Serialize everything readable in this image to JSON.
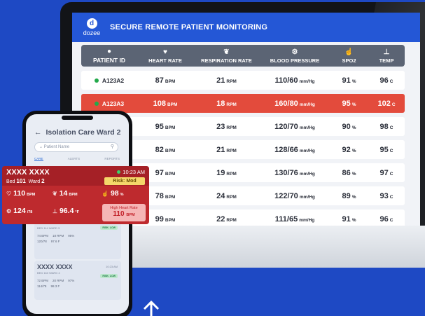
{
  "brand": {
    "logo_letter": "d",
    "logo_text": "dozee"
  },
  "app_title": "SECURE REMOTE PATIENT MONITORING",
  "columns": [
    {
      "label": "PATIENT ID",
      "icon": "person-icon"
    },
    {
      "label": "HEART RATE",
      "icon": "heart-icon"
    },
    {
      "label": "RESPIRATION RATE",
      "icon": "lungs-icon"
    },
    {
      "label": "BLOOD PRESSURE",
      "icon": "bp-icon"
    },
    {
      "label": "SPO2",
      "icon": "finger-icon"
    },
    {
      "label": "TEMP",
      "icon": "thermometer-icon"
    }
  ],
  "rows": [
    {
      "id": "A123A2",
      "hr": "87",
      "hr_unit": "BPM",
      "rr": "21",
      "rr_unit": "RPM",
      "bp": "110/60",
      "bp_unit": "mm/Hg",
      "spo2": "91",
      "spo2_unit": "%",
      "temp": "96",
      "temp_unit": "C",
      "alert": false
    },
    {
      "id": "A123A3",
      "hr": "108",
      "hr_unit": "BPM",
      "rr": "18",
      "rr_unit": "RPM",
      "bp": "160/80",
      "bp_unit": "mm/Hg",
      "spo2": "95",
      "spo2_unit": "%",
      "temp": "102",
      "temp_unit": "C",
      "alert": true
    },
    {
      "id": "",
      "hr": "95",
      "hr_unit": "BPM",
      "rr": "23",
      "rr_unit": "RPM",
      "bp": "120/70",
      "bp_unit": "mm/Hg",
      "spo2": "90",
      "spo2_unit": "%",
      "temp": "98",
      "temp_unit": "C",
      "alert": false
    },
    {
      "id": "",
      "hr": "82",
      "hr_unit": "BPM",
      "rr": "21",
      "rr_unit": "RPM",
      "bp": "128/66",
      "bp_unit": "mm/Hg",
      "spo2": "92",
      "spo2_unit": "%",
      "temp": "95",
      "temp_unit": "C",
      "alert": false
    },
    {
      "id": "",
      "hr": "97",
      "hr_unit": "BPM",
      "rr": "19",
      "rr_unit": "RPM",
      "bp": "130/76",
      "bp_unit": "mm/Hg",
      "spo2": "86",
      "spo2_unit": "%",
      "temp": "97",
      "temp_unit": "C",
      "alert": false
    },
    {
      "id": "",
      "hr": "78",
      "hr_unit": "BPM",
      "rr": "24",
      "rr_unit": "RPM",
      "bp": "122/70",
      "bp_unit": "mm/Hg",
      "spo2": "89",
      "spo2_unit": "%",
      "temp": "93",
      "temp_unit": "C",
      "alert": false
    },
    {
      "id": "",
      "hr": "99",
      "hr_unit": "BPM",
      "rr": "22",
      "rr_unit": "RPM",
      "bp": "111/65",
      "bp_unit": "mm/Hg",
      "spo2": "91",
      "spo2_unit": "%",
      "temp": "96",
      "temp_unit": "C",
      "alert": false
    }
  ],
  "phone": {
    "title": "Isolation Care Ward 2",
    "search_placeholder": "Patient Name",
    "tabs": [
      "CARE",
      "ALERTS",
      "REPORTS"
    ],
    "card1": {
      "bed": "BED 114",
      "ward": "WARD 3",
      "risk": "RISK: LOW",
      "hr": "74 BPM",
      "rr": "18 RPM",
      "spo2": "95%",
      "bp": "120/78",
      "temp": "97.6 F"
    },
    "card2": {
      "name": "XXXX XXXX",
      "time": "10:23 AM",
      "bed": "BED 163",
      "ward": "WARD 4",
      "risk": "RISK: LOW",
      "hr": "72 BPM",
      "rr": "20 RPM",
      "spo2": "97%",
      "bp": "114/78",
      "temp": "98.3 F"
    }
  },
  "alert_card": {
    "name": "XXXX XXXX",
    "bed_label": "Bed",
    "bed": "101",
    "ward_label": "Ward",
    "ward": "2",
    "time": "10:23 AM",
    "risk": "Risk: Mod",
    "hr": "110",
    "hr_unit": "BPM",
    "rr": "14",
    "rr_unit": "BPM",
    "spo2": "98",
    "spo2_unit": "%",
    "bp": "124",
    "bp_unit": "/78",
    "temp": "96.4",
    "temp_unit": "°F",
    "hr_alert_label": "High Heart Rate",
    "hr_alert_value": "110",
    "hr_alert_unit": "BPM"
  },
  "colors": {
    "background": "#1e49c4",
    "header": "#2457d6",
    "alert_row": "#e34b3c",
    "alert_card": "#be2a2e",
    "risk_mod": "#f4d76a",
    "status_dot": "#23a94a"
  }
}
